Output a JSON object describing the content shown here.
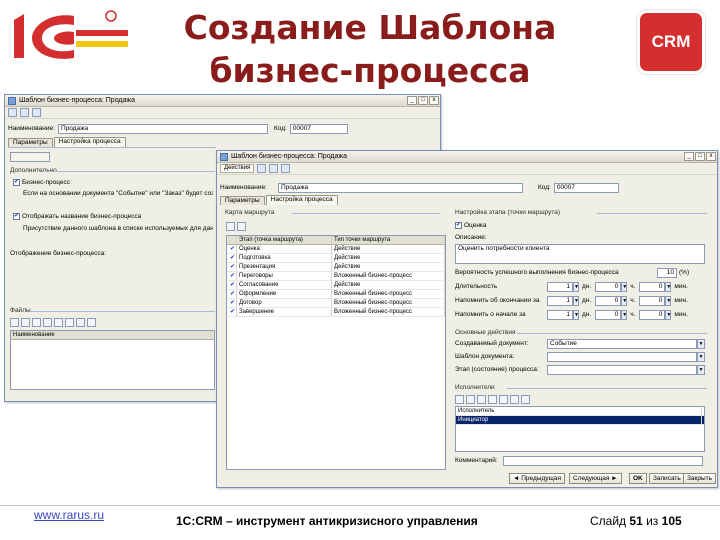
{
  "slide": {
    "title_line1": "Создание Шаблона",
    "title_line2": "бизнес-процесса",
    "badge": "CRM",
    "footer_url": "www.rarus.ru",
    "footer_caption": "1С:CRM – инструмент антикризисного управления",
    "page_prefix": "Слайд",
    "page_current": "51",
    "page_sep": "из",
    "page_total": "105"
  },
  "colors": {
    "title": "#8a1c1c",
    "badge": "#d42e2e",
    "logo": "#d42e2e",
    "logo_accent": "#f0c814",
    "link": "#3a46c8",
    "selection": "#0a246a"
  },
  "back_window": {
    "title": "Шаблон бизнес-процесса: Продажа",
    "name_label": "Наименование:",
    "name_value": "Продажа",
    "code_label": "Код:",
    "code_value": "00007",
    "tabs": [
      "Параметры",
      "Настройка процесса"
    ],
    "dop_label": "Дополнительно",
    "check1": "Бизнес-процесс",
    "check1_text": "Если на основании документа \"Событие\" или \"Заказ\" будет создан бизнес-процесс, то",
    "check2": "Отображать название бизнес-процесса",
    "check2_text": "Присутствие данного шаблона в списке используемых для данного основания",
    "display_label": "Отображение бизнес-процесса:",
    "files_label": "Файлы",
    "files_col": "Наименование"
  },
  "front_window": {
    "title": "Шаблон бизнес-процесса: Продажа",
    "toolbar_actions": "Действия",
    "name_label": "Наименование:",
    "name_value": "Продажа",
    "code_label": "Код:",
    "code_value": "00007",
    "tabs": [
      "Параметры",
      "Настройка процесса"
    ],
    "route_map_label": "Карта маршрута",
    "route_headers": [
      "Этап (точка маршрута)",
      "Тип точки маршрута"
    ],
    "route_rows": [
      {
        "check": "✔",
        "stage": "Оценка",
        "type": "Действие",
        "selected": false
      },
      {
        "check": "✔",
        "stage": "Подготовка",
        "type": "Действие",
        "selected": false
      },
      {
        "check": "✔",
        "stage": "Презентация",
        "type": "Действие",
        "selected": false
      },
      {
        "check": "✔",
        "stage": "Переговоры",
        "type": "Вложенный бизнес-процесс",
        "selected": false
      },
      {
        "check": "✔",
        "stage": "Согласование",
        "type": "Действие",
        "selected": false
      },
      {
        "check": "✔",
        "stage": "Оформление",
        "type": "Вложенный бизнес-процесс",
        "selected": false
      },
      {
        "check": "✔",
        "stage": "Договор",
        "type": "Вложенный бизнес-процесс",
        "selected": false
      },
      {
        "check": "✔",
        "stage": "Завершение",
        "type": "Вложенный бизнес-процесс",
        "selected": false
      }
    ],
    "stage_settings_label": "Настройка этапа (точки маршрута)",
    "stage_check": "Оценка",
    "description_label": "Описание:",
    "description_value": "Оценить потребности клиента",
    "duration_hint": "Вероятность успешного выполнения бизнес-процесса",
    "duration_value": "10",
    "duration_unit": "(%)",
    "rows_time": [
      {
        "label": "Длительность",
        "d": "1",
        "h": "0",
        "m": "0"
      },
      {
        "label": "Напомнить об окончании за",
        "d": "1",
        "h": "0",
        "m": "0"
      },
      {
        "label": "Напомнить о начале за",
        "d": "1",
        "h": "0",
        "m": "0"
      }
    ],
    "unit_d": "дн.",
    "unit_h": "ч.",
    "unit_m": "мин.",
    "main_action_label": "Основные действия",
    "create_doc_label": "Создаваемый документ:",
    "create_doc_value": "Событие",
    "template_label": "Шаблон документа:",
    "template_value": "",
    "state_label": "Этап (состояние) процесса:",
    "state_value": "",
    "exec_label": "Исполнители",
    "exec_rows": [
      {
        "name": "Исполнитель",
        "selected": false
      },
      {
        "name": "Инициатор",
        "selected": true
      }
    ],
    "comment_label": "Комментарий:",
    "btn_prev": "Предыдущая",
    "btn_next": "Следующая",
    "btn_ok": "OK",
    "btn_save": "Записать",
    "btn_close": "Закрыть"
  }
}
